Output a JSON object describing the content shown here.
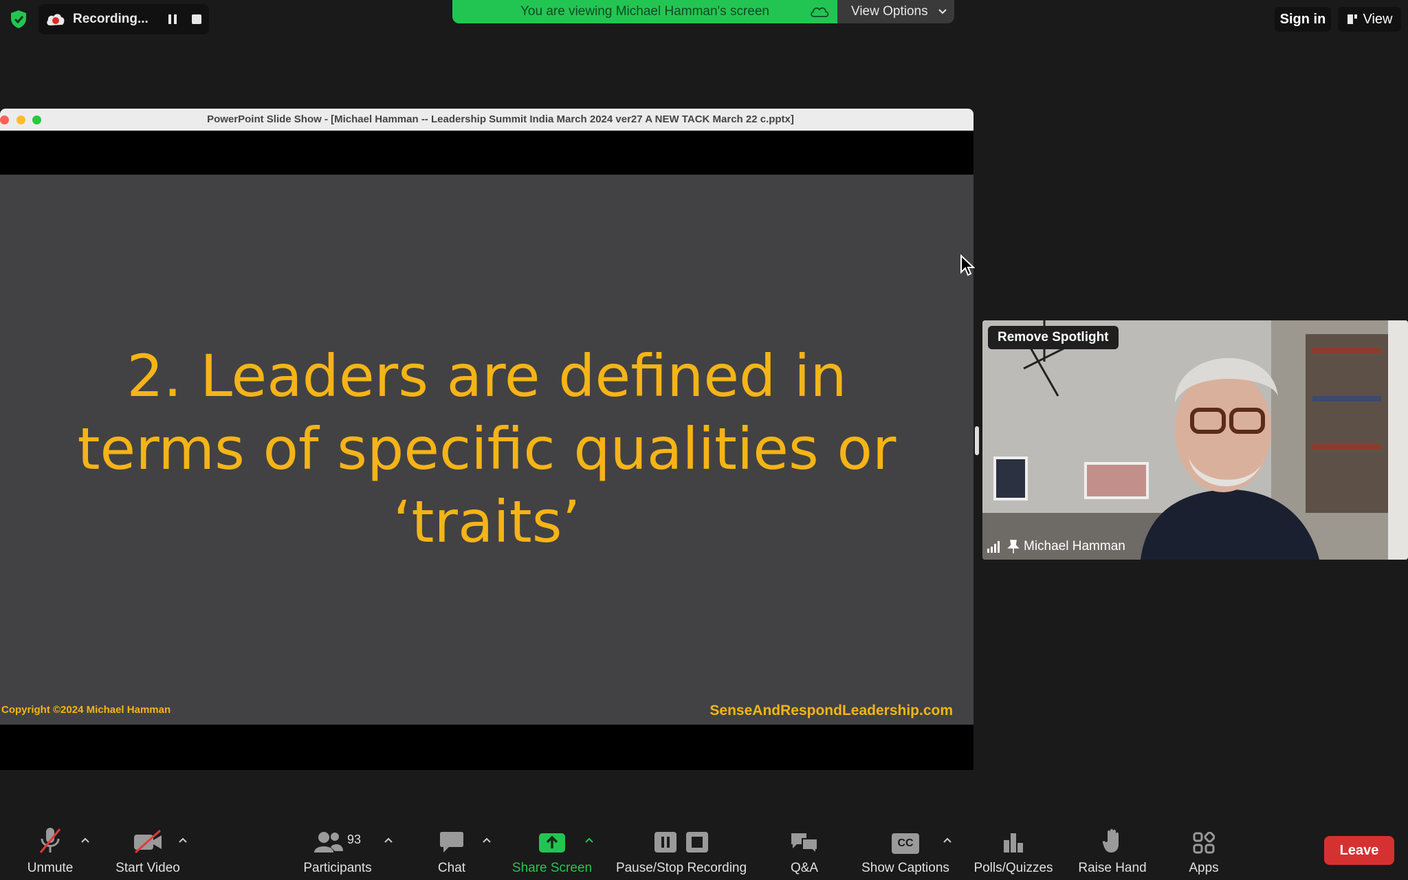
{
  "top_bar": {
    "recording_label": "Recording...",
    "viewing_banner": "You are viewing Michael Hamman's screen",
    "view_options_label": "View Options",
    "sign_in_label": "Sign in",
    "view_label": "View"
  },
  "shared_window": {
    "title": "PowerPoint Slide Show - [Michael Hamman -- Leadership Summit India March 2024 ver27 A NEW TACK March 22 c.pptx]",
    "slide": {
      "headline_line1": "2. Leaders are defined in",
      "headline_line2": "terms of specific qualities or",
      "headline_line3": "‘traits’",
      "copyright": "Copyright ©2024 Michael Hamman",
      "website": "SenseAndRespondLeadership.com"
    }
  },
  "video_tile": {
    "spotlight_button": "Remove Spotlight",
    "participant_name": "Michael Hamman"
  },
  "toolbar": {
    "unmute": "Unmute",
    "start_video": "Start Video",
    "participants": "Participants",
    "participants_count": "93",
    "chat": "Chat",
    "share_screen": "Share Screen",
    "pause_stop_recording": "Pause/Stop Recording",
    "qa": "Q&A",
    "cc_badge": "CC",
    "show_captions": "Show Captions",
    "polls": "Polls/Quizzes",
    "raise_hand": "Raise Hand",
    "apps": "Apps",
    "leave": "Leave"
  },
  "colors": {
    "accent_green": "#23c552",
    "slide_text": "#f5b417",
    "leave_red": "#d63131"
  }
}
